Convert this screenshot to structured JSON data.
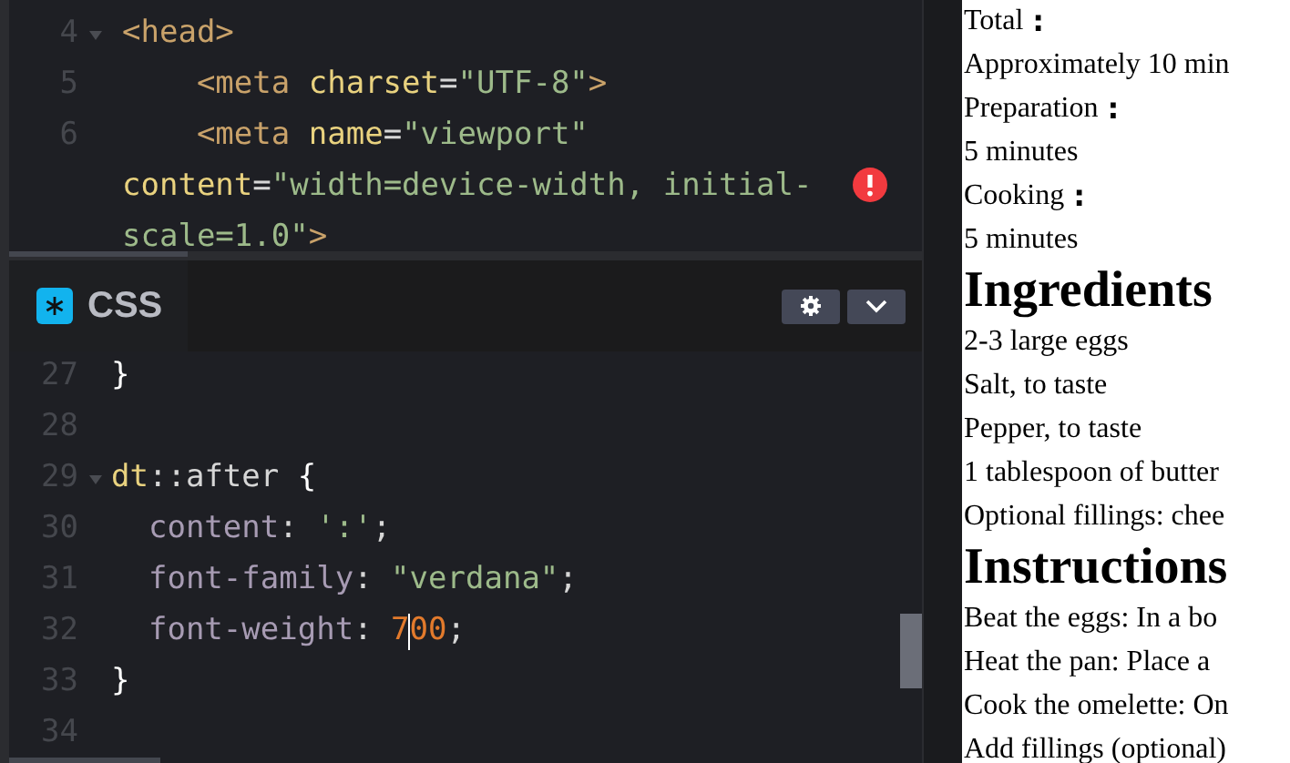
{
  "html_editor": {
    "lines": [
      {
        "number": "4",
        "foldable": true,
        "tokens": [
          {
            "kind": "tag",
            "text": "<head>"
          }
        ]
      },
      {
        "number": "5",
        "foldable": false,
        "tokens": [
          {
            "kind": "tag",
            "text": "    <meta "
          },
          {
            "kind": "attr",
            "text": "charset"
          },
          {
            "kind": "plain",
            "text": "="
          },
          {
            "kind": "string",
            "text": "\"UTF-8\""
          },
          {
            "kind": "tag",
            "text": ">"
          }
        ]
      },
      {
        "number": "6",
        "foldable": false,
        "tokens": [
          {
            "kind": "tag",
            "text": "    <meta "
          },
          {
            "kind": "attr",
            "text": "name"
          },
          {
            "kind": "plain",
            "text": "="
          },
          {
            "kind": "string",
            "text": "\"viewport\""
          }
        ]
      },
      {
        "foldable": false,
        "error": true,
        "tokens": [
          {
            "kind": "attr",
            "text": "content"
          },
          {
            "kind": "plain",
            "text": "="
          },
          {
            "kind": "string",
            "text": "\"width=device-width, initial-"
          }
        ]
      },
      {
        "foldable": false,
        "tokens": [
          {
            "kind": "string",
            "text": "scale=1.0\""
          },
          {
            "kind": "tag",
            "text": ">"
          }
        ]
      }
    ]
  },
  "css_editor": {
    "title": "CSS",
    "lines": [
      {
        "number": "27",
        "foldable": false,
        "tokens": [
          {
            "kind": "brace",
            "text": "}"
          }
        ]
      },
      {
        "number": "28",
        "foldable": false
      },
      {
        "number": "29",
        "foldable": true,
        "tokens": [
          {
            "kind": "selector",
            "text": "dt"
          },
          {
            "kind": "plain",
            "text": "::after "
          },
          {
            "kind": "brace",
            "text": "{"
          }
        ]
      },
      {
        "number": "30",
        "foldable": false,
        "tokens": [
          {
            "kind": "property",
            "text": "  content"
          },
          {
            "kind": "plain",
            "text": ": "
          },
          {
            "kind": "string",
            "text": "':'"
          },
          {
            "kind": "plain",
            "text": ";"
          }
        ]
      },
      {
        "number": "31",
        "foldable": false,
        "tokens": [
          {
            "kind": "property",
            "text": "  font-family"
          },
          {
            "kind": "plain",
            "text": ": "
          },
          {
            "kind": "string",
            "text": "\"verdana\""
          },
          {
            "kind": "plain",
            "text": ";"
          }
        ]
      },
      {
        "number": "32",
        "foldable": false,
        "tokens": [
          {
            "kind": "property",
            "text": "  font-weight"
          },
          {
            "kind": "plain",
            "text": ": "
          },
          {
            "kind": "number",
            "text": "7",
            "cursor_after": true
          },
          {
            "kind": "number",
            "text": "00"
          },
          {
            "kind": "plain",
            "text": ";"
          }
        ]
      },
      {
        "number": "33",
        "foldable": false,
        "tokens": [
          {
            "kind": "brace",
            "text": "}"
          }
        ]
      },
      {
        "number": "34",
        "foldable": false
      }
    ]
  },
  "preview": {
    "items": [
      {
        "kind": "term",
        "text": "Total",
        "suffix": ":"
      },
      {
        "kind": "detail",
        "text": "Approximately 10 min"
      },
      {
        "kind": "term",
        "text": "Preparation",
        "suffix": ":"
      },
      {
        "kind": "detail",
        "text": "5 minutes"
      },
      {
        "kind": "term",
        "text": "Cooking",
        "suffix": ":"
      },
      {
        "kind": "detail",
        "text": "5 minutes"
      },
      {
        "kind": "heading",
        "text": "Ingredients"
      },
      {
        "kind": "item",
        "text": "2-3 large eggs"
      },
      {
        "kind": "item",
        "text": "Salt, to taste"
      },
      {
        "kind": "item",
        "text": "Pepper, to taste"
      },
      {
        "kind": "item",
        "text": "1 tablespoon of butter"
      },
      {
        "kind": "item",
        "text": "Optional fillings: chee"
      },
      {
        "kind": "heading",
        "text": "Instructions"
      },
      {
        "kind": "item",
        "text": "Beat the eggs: In a bo"
      },
      {
        "kind": "item",
        "text": "Heat the pan: Place a"
      },
      {
        "kind": "item",
        "text": "Cook the omelette: On"
      },
      {
        "kind": "item",
        "text": "Add fillings (optional)"
      }
    ]
  }
}
